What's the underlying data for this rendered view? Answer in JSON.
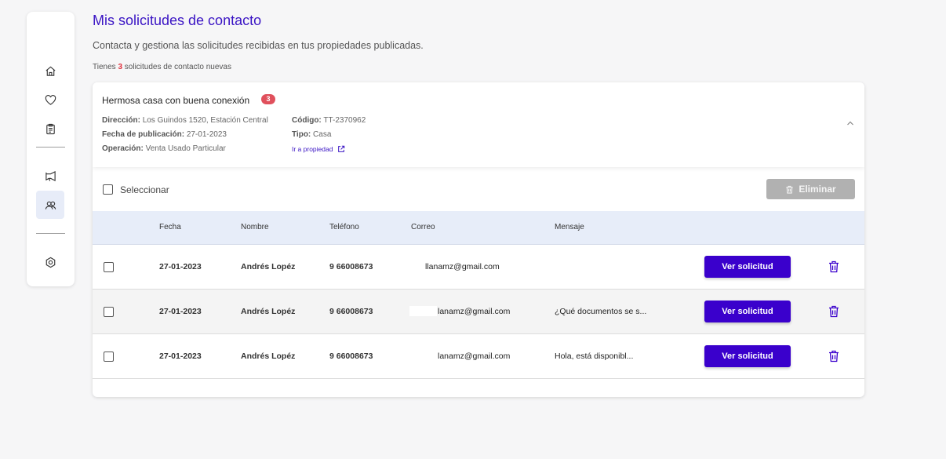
{
  "page": {
    "title": "Mis solicitudes de contacto",
    "subtitle": "Contacta y gestiona las solicitudes recibidas en tus propiedades publicadas.",
    "counter_prefix": "Tienes",
    "counter_value": "3",
    "counter_suffix": "solicitudes de contacto nuevas"
  },
  "sidebar": {
    "items": [
      {
        "icon": "home-icon"
      },
      {
        "icon": "heart-icon"
      },
      {
        "icon": "clipboard-icon"
      },
      {
        "icon": "megaphone-icon"
      },
      {
        "icon": "users-icon",
        "active": true
      },
      {
        "icon": "settings-icon"
      }
    ]
  },
  "property": {
    "name": "Hermosa casa con buena conexión",
    "badge": "3",
    "direccion_label": "Dirección:",
    "direccion": "Los Guindos 1520, Estación Central",
    "fecha_label": "Fecha de publicación:",
    "fecha": "27-01-2023",
    "operacion_label": "Operación:",
    "operacion": "Venta Usado Particular",
    "codigo_label": "Código:",
    "codigo": "TT-2370962",
    "tipo_label": "Tipo:",
    "tipo": "Casa",
    "link": "Ir a propiedad"
  },
  "toolbar": {
    "select_label": "Seleccionar",
    "delete_label": "Eliminar"
  },
  "table": {
    "columns": [
      "Fecha",
      "Nombre",
      "Teléfono",
      "Correo",
      "Mensaje"
    ],
    "rows": [
      {
        "fecha": "27-01-2023",
        "nombre": "Andrés Lopéz",
        "telefono": "9 66008673",
        "correo": "llanamz@gmail.com",
        "mensaje": "",
        "action": "Ver solicitud"
      },
      {
        "fecha": "27-01-2023",
        "nombre": "Andrés Lopéz",
        "telefono": "9 66008673",
        "correo": "lanamz@gmail.com",
        "mensaje": "¿Qué documentos se s...",
        "action": "Ver solicitud"
      },
      {
        "fecha": "27-01-2023",
        "nombre": "Andrés Lopéz",
        "telefono": "9 66008673",
        "correo": "lanamz@gmail.com",
        "mensaje": "Hola, está disponibl...",
        "action": "Ver solicitud"
      }
    ]
  },
  "colors": {
    "primary": "#3a00cc",
    "title": "#3a14c4",
    "badge": "#e0505c",
    "header_bg": "#e7edf9",
    "disabled": "#b1b1b1"
  }
}
